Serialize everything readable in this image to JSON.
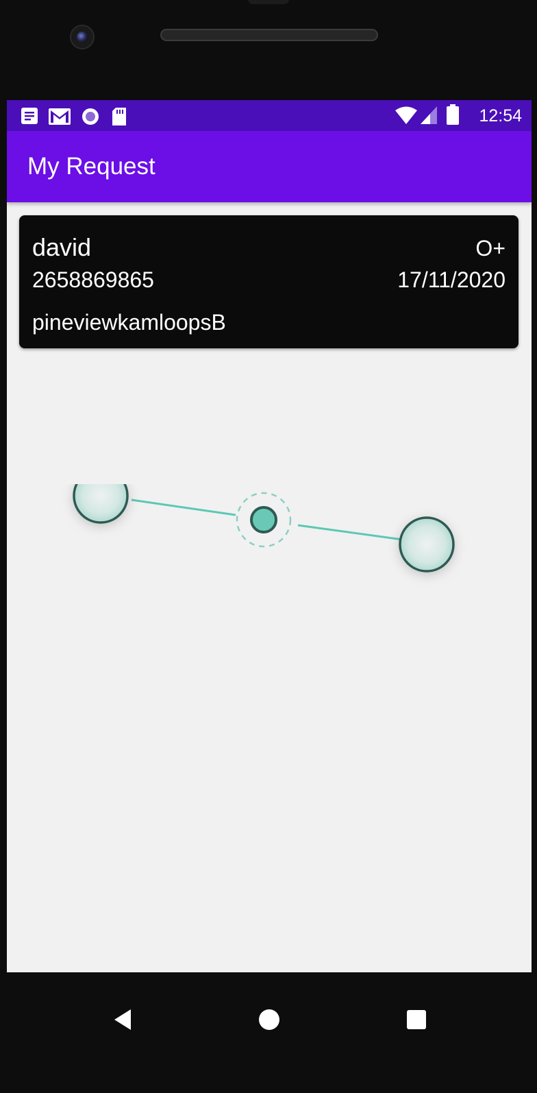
{
  "status_bar": {
    "time": "12:54",
    "left_icons": [
      "notes-icon",
      "gmail-icon",
      "record-icon",
      "sd-card-icon"
    ],
    "right_icons": [
      "wifi-icon",
      "signal-icon",
      "battery-icon"
    ]
  },
  "app_bar": {
    "title": "My Request",
    "color": "#6b0fe6"
  },
  "request_card": {
    "name": "david",
    "blood_group": "O+",
    "phone": "2658869865",
    "date": "17/11/2020",
    "address": "pineviewkamloopsB"
  },
  "loading_indicator": {
    "accent": "#5cc8b4"
  },
  "nav_bar": {
    "buttons": [
      "back-icon",
      "home-icon",
      "recents-icon"
    ]
  }
}
